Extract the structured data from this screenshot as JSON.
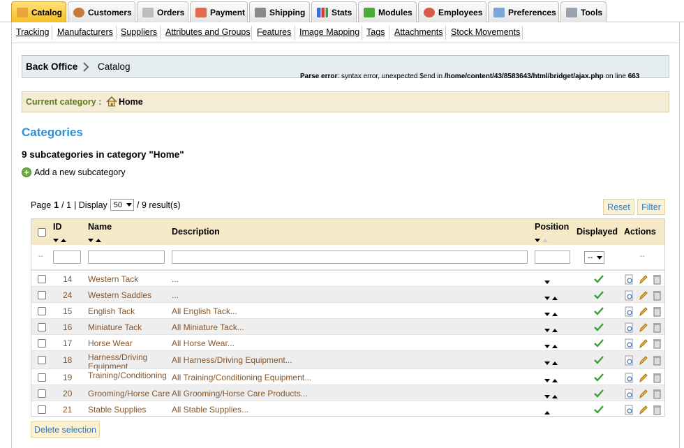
{
  "tabs": [
    {
      "label": "Catalog",
      "active": true
    },
    {
      "label": "Customers"
    },
    {
      "label": "Orders"
    },
    {
      "label": "Payment"
    },
    {
      "label": "Shipping"
    },
    {
      "label": "Stats"
    },
    {
      "label": "Modules"
    },
    {
      "label": "Employees"
    },
    {
      "label": "Preferences"
    },
    {
      "label": "Tools"
    }
  ],
  "subtabs": [
    "Tracking",
    "Manufacturers",
    "Suppliers",
    "Attributes and Groups",
    "Features",
    "Image Mapping",
    "Tags",
    "Attachments",
    "Stock Movements"
  ],
  "breadcrumb": {
    "root": "Back Office",
    "current": "Catalog"
  },
  "parse_error": {
    "label": "Parse error",
    "message": ": syntax error, unexpected $end in ",
    "path": "/home/content/43/8583643/html/bridget/ajax.php",
    "on": " on line ",
    "line": "663"
  },
  "current_category": {
    "label": "Current category :",
    "value": "Home"
  },
  "page_title": "Categories",
  "subtitle": "9 subcategories in category \"Home\"",
  "add_link": "Add a new subcategory",
  "pager": {
    "page_label": "Page",
    "page": "1",
    "total_pages": "/ 1",
    "display_label": "| Display",
    "per_page": "50",
    "results": "/ 9 result(s)"
  },
  "buttons": {
    "reset": "Reset",
    "filter": "Filter",
    "delete": "Delete selection"
  },
  "columns": {
    "id": "ID",
    "name": "Name",
    "description": "Description",
    "position": "Position",
    "displayed": "Displayed",
    "actions": "Actions"
  },
  "filter": {
    "dash_left": "--",
    "displayed_value": "--",
    "dash_right": "--"
  },
  "rows": [
    {
      "id": "14",
      "name": "Western Tack",
      "description": "...",
      "pos": "down"
    },
    {
      "id": "24",
      "name": "Western Saddles",
      "description": "...",
      "pos": "both"
    },
    {
      "id": "15",
      "name": "English Tack",
      "description": "All English Tack...",
      "pos": "both"
    },
    {
      "id": "16",
      "name": "Miniature Tack",
      "description": "All Miniature Tack...",
      "pos": "both"
    },
    {
      "id": "17",
      "name": "Horse Wear",
      "description": "All Horse Wear...",
      "pos": "both"
    },
    {
      "id": "18",
      "name": "Harness/Driving Equipment",
      "description": "All Harness/Driving Equipment...",
      "pos": "both"
    },
    {
      "id": "19",
      "name": "Training/Conditioning",
      "description": "All Training/Conditioning Equipment...",
      "pos": "both"
    },
    {
      "id": "20",
      "name": "Grooming/Horse Care",
      "description": "All Grooming/Horse Care Products...",
      "pos": "both"
    },
    {
      "id": "21",
      "name": "Stable Supplies",
      "description": "All Stable Supplies...",
      "pos": "up"
    }
  ],
  "colors": {
    "accent": "#2e8fd0",
    "row_text": "#85562c",
    "header_bg": "#f5e9c8",
    "active_tab": "#f5c026"
  }
}
